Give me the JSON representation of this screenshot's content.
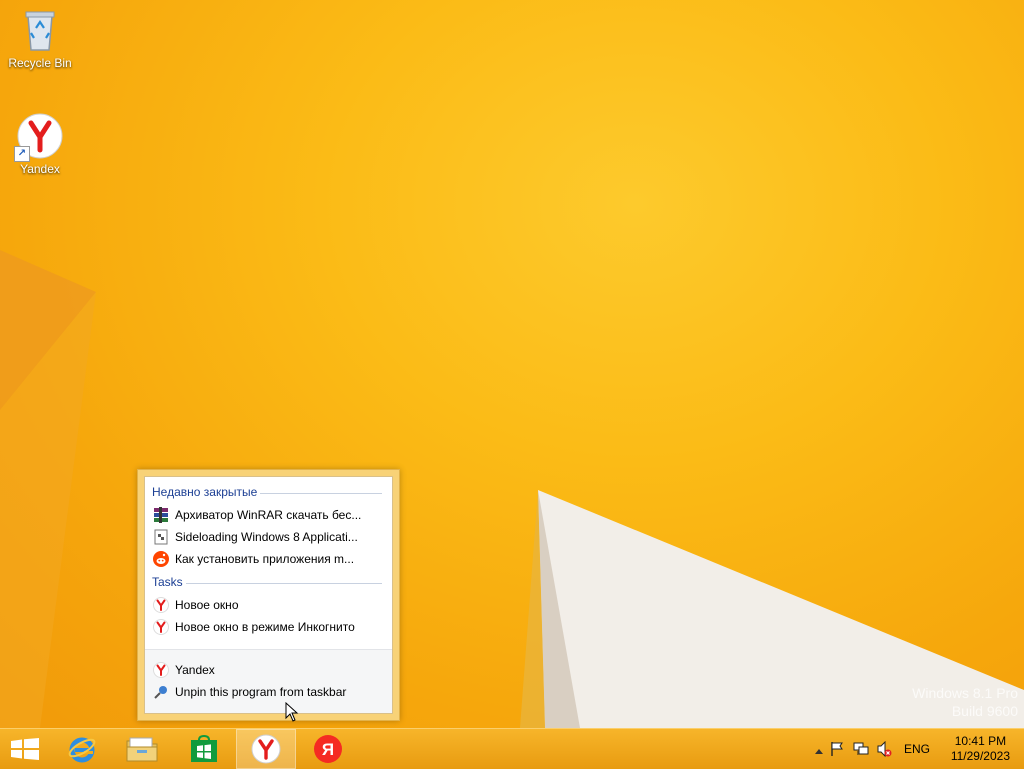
{
  "desktop": {
    "icons": [
      {
        "label": "Recycle Bin",
        "icon": "recycle-bin-icon"
      },
      {
        "label": "Yandex",
        "icon": "yandex-browser-icon"
      }
    ],
    "watermark": {
      "line1": "Windows 8.1 Pro",
      "line2": "Build 9600"
    }
  },
  "jumplist": {
    "recent_header": "Недавно закрытые",
    "recent": [
      {
        "label": "Архиватор WinRAR скачать бес...",
        "icon": "winrar-icon"
      },
      {
        "label": "Sideloading Windows 8 Applicati...",
        "icon": "page-icon"
      },
      {
        "label": "Как установить приложения m...",
        "icon": "reddit-icon"
      }
    ],
    "tasks_header": "Tasks",
    "tasks": [
      {
        "label": "Новое окно",
        "icon": "yandex-icon"
      },
      {
        "label": "Новое окно в режиме Инкогнито",
        "icon": "yandex-icon"
      }
    ],
    "app": {
      "label": "Yandex",
      "icon": "yandex-icon"
    },
    "unpin": {
      "label": "Unpin this program from taskbar",
      "icon": "pin-icon"
    }
  },
  "taskbar": {
    "buttons": [
      {
        "name": "start-button",
        "icon": "windows-logo-icon"
      },
      {
        "name": "internet-explorer",
        "icon": "ie-icon"
      },
      {
        "name": "file-explorer",
        "icon": "folder-icon"
      },
      {
        "name": "store",
        "icon": "store-icon"
      },
      {
        "name": "yandex-browser",
        "icon": "yandex-browser-icon",
        "active": true
      },
      {
        "name": "yandex",
        "icon": "yandex-ya-icon"
      }
    ],
    "tray": {
      "language": "ENG",
      "time": "10:41 PM",
      "date": "11/29/2023"
    }
  },
  "colors": {
    "desktop": "#f6ad0d",
    "jumplist_header": "#1c3f94",
    "yandex_red": "#e31d1d"
  }
}
